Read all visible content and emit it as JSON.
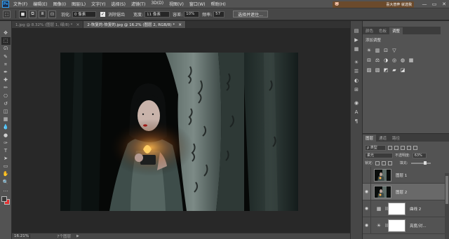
{
  "app": {
    "logo_text": "Ps"
  },
  "menu": [
    "文件(F)",
    "编辑(E)",
    "图像(I)",
    "图层(L)",
    "文字(Y)",
    "选择(S)",
    "滤镜(T)",
    "3D(D)",
    "视图(V)",
    "窗口(W)",
    "帮助(H)"
  ],
  "banner": {
    "text": "喜大普奔 就选我",
    "icon": "pig-icon"
  },
  "window_controls": [
    "—",
    "▭",
    "✕"
  ],
  "options": {
    "feather_label": "羽化:",
    "feather_value": "0 像素",
    "antialias_label": "消除锯齿",
    "antialias_checked": true,
    "style_label": "样式:",
    "style_value": "正常",
    "width_label": "宽度:",
    "height_label": "高度:",
    "select_mask_button": "选择并遮住...",
    "alt_value_1": "11 像素",
    "alt_label_2": "容差:",
    "alt_value_2": "10%",
    "alt_label_3": "频率:",
    "alt_value_3": "57"
  },
  "tabs": [
    {
      "label": "1.jpg @ 8.32% (图层 1, 绿/8) *",
      "active": false
    },
    {
      "label": "2-恢复的-恢复的.jpg @ 16.2% (图层 2, RGB/8) *",
      "active": true
    }
  ],
  "tools": [
    "move-icon",
    "marquee-icon",
    "lasso-icon",
    "quick-select-icon",
    "crop-icon",
    "eyedropper-icon",
    "healing-icon",
    "brush-icon",
    "clone-stamp-icon",
    "history-brush-icon",
    "eraser-icon",
    "gradient-icon",
    "blur-icon",
    "dodge-icon",
    "pen-icon",
    "type-icon",
    "path-select-icon",
    "shape-icon",
    "hand-icon",
    "zoom-icon",
    "more-icon"
  ],
  "tool_glyphs": [
    "✥",
    "⬚",
    "ᘏ",
    "✎",
    "⌗",
    "✒",
    "✚",
    "✏",
    "⎔",
    "↺",
    "◫",
    "▦",
    "💧",
    "●",
    "✑",
    "T",
    "➤",
    "▭",
    "✋",
    "🔍",
    "…"
  ],
  "swatches": {
    "foreground": "#3a3a3a",
    "background": "#e03030"
  },
  "status": {
    "zoom": "16.21%",
    "doc": "7个图层",
    "arrow": "▶"
  },
  "icon_strip_glyphs": [
    "▤",
    "▶",
    "▦",
    "☀",
    "☰",
    "◐",
    "⊞",
    "◉",
    "A",
    "¶"
  ],
  "panel_top": {
    "tabs": [
      "颜色",
      "色板",
      "调整"
    ],
    "active_tab": 2,
    "title": "添加调整"
  },
  "adjust_rows": [
    [
      "☀",
      "▥",
      "⊡",
      "▽"
    ],
    [
      "⊟",
      "⚖",
      "◑",
      "◎",
      "◍",
      "▦"
    ],
    [
      "▨",
      "▧",
      "◩",
      "▰",
      "◪"
    ]
  ],
  "layers_panel": {
    "tabs": [
      "图层",
      "通道",
      "路径"
    ],
    "active_tab": 0,
    "filter_kind": "ρ 类型",
    "blend_mode": "柔光",
    "opacity_label": "不透明度:",
    "opacity_value": "63%",
    "lock_label": "锁定:",
    "fill_label": "填充:",
    "fill_value": "100%",
    "layers": [
      {
        "name": "图层 1",
        "type": "photo",
        "visible": false,
        "selected": false
      },
      {
        "name": "图层 2",
        "type": "photo",
        "visible": true,
        "selected": true
      },
      {
        "name": "曲线 2",
        "type": "adjustment",
        "icon": "▦",
        "visible": true,
        "selected": false
      },
      {
        "name": "亮度/对...",
        "type": "adjustment",
        "icon": "☀",
        "visible": true,
        "selected": false
      }
    ]
  }
}
